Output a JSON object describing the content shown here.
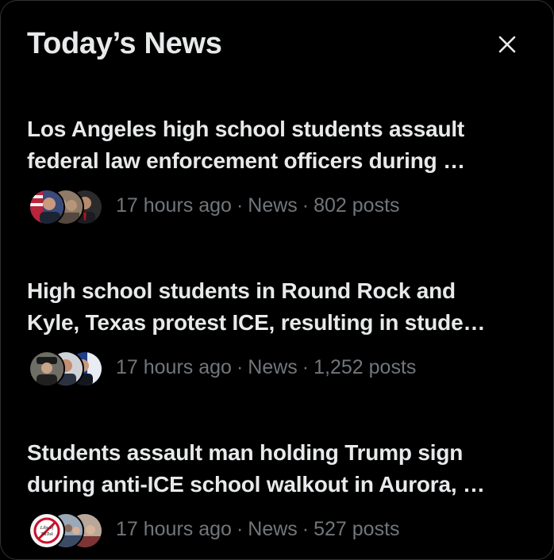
{
  "header": {
    "title": "Today’s News",
    "close_icon": "close-icon"
  },
  "news": [
    {
      "line1": "Los Angeles high school students assault",
      "line2": "federal law enforcement officers during …",
      "time": "17 hours ago",
      "category": "News",
      "posts": "802 posts"
    },
    {
      "line1": "High school students in Round Rock and",
      "line2": "Kyle, Texas protest ICE, resulting in stude…",
      "time": "17 hours ago",
      "category": "News",
      "posts": "1,252 posts"
    },
    {
      "line1": "Students assault man holding Trump sign",
      "line2": "during anti-ICE school walkout in Aurora, …",
      "time": "17 hours ago",
      "category": "News",
      "posts": "527 posts"
    }
  ],
  "avatars": {
    "item1": [
      "avatar-man-with-flag",
      "avatar-group-photo",
      "avatar-man-in-suit"
    ],
    "item2": [
      "avatar-man-in-hat",
      "avatar-man-portrait",
      "avatar-man-with-flag-blue"
    ],
    "item3": [
      "avatar-libs-of-tiktok-logo",
      "avatar-crowd-photo",
      "avatar-crowd-photo-2"
    ],
    "libs_logo_text": "Libs of TikTok"
  },
  "colors": {
    "background": "#000000",
    "text_primary": "#e7e9ea",
    "text_secondary": "#71767b"
  }
}
